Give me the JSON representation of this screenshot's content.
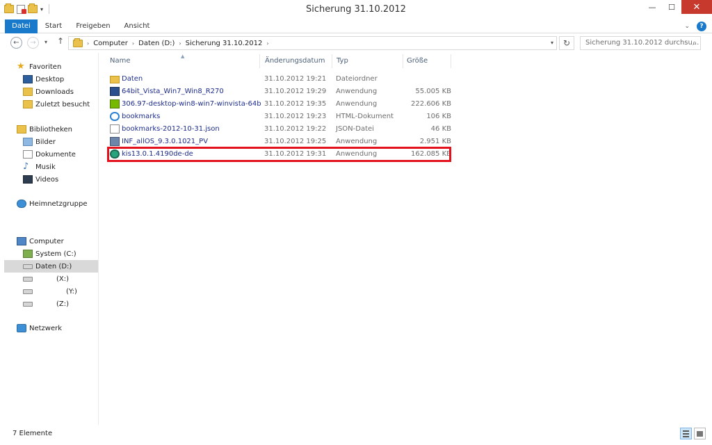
{
  "window": {
    "title": "Sicherung 31.10.2012"
  },
  "ribbon": {
    "tabs": [
      "Datei",
      "Start",
      "Freigeben",
      "Ansicht"
    ]
  },
  "navigation": {
    "breadcrumb": [
      "Computer",
      "Daten (D:)",
      "Sicherung 31.10.2012"
    ],
    "search_placeholder": "Sicherung 31.10.2012 durchsu..."
  },
  "sidebar": {
    "favorites": {
      "label": "Favoriten",
      "items": [
        "Desktop",
        "Downloads",
        "Zuletzt besucht"
      ]
    },
    "libraries": {
      "label": "Bibliotheken",
      "items": [
        "Bilder",
        "Dokumente",
        "Musik",
        "Videos"
      ]
    },
    "homegroup": "Heimnetzgruppe",
    "computer": {
      "label": "Computer",
      "items": [
        "System (C:)",
        "Daten (D:)",
        "(X:)",
        "(Y:)",
        "(Z:)"
      ],
      "selected": "Daten (D:)"
    },
    "network": "Netzwerk"
  },
  "columns": [
    "Name",
    "Änderungsdatum",
    "Typ",
    "Größe"
  ],
  "files": [
    {
      "name": "Daten",
      "date": "31.10.2012 19:21",
      "type": "Dateiordner",
      "size": "",
      "icon": "folder-icon"
    },
    {
      "name": "64bit_Vista_Win7_Win8_R270",
      "date": "31.10.2012 19:29",
      "type": "Anwendung",
      "size": "55.005 KB",
      "icon": "setup-app-icon"
    },
    {
      "name": "306.97-desktop-win8-win7-winvista-64bi...",
      "date": "31.10.2012 19:35",
      "type": "Anwendung",
      "size": "222.606 KB",
      "icon": "nvidia-icon"
    },
    {
      "name": "bookmarks",
      "date": "31.10.2012 19:23",
      "type": "HTML-Dokument",
      "size": "106 KB",
      "icon": "internet-explorer-icon"
    },
    {
      "name": "bookmarks-2012-10-31.json",
      "date": "31.10.2012 19:22",
      "type": "JSON-Datei",
      "size": "46 KB",
      "icon": "document-icon"
    },
    {
      "name": "INF_allOS_9.3.0.1021_PV",
      "date": "31.10.2012 19:25",
      "type": "Anwendung",
      "size": "2.951 KB",
      "icon": "installer-icon"
    },
    {
      "name": "kis13.0.1.4190de-de",
      "date": "31.10.2012 19:31",
      "type": "Anwendung",
      "size": "162.085 KB",
      "icon": "kaspersky-icon"
    }
  ],
  "status": {
    "count": "7 Elemente"
  },
  "colors": {
    "accent": "#1979ca",
    "highlight": "#e2111b",
    "link": "#1e2d8c"
  }
}
